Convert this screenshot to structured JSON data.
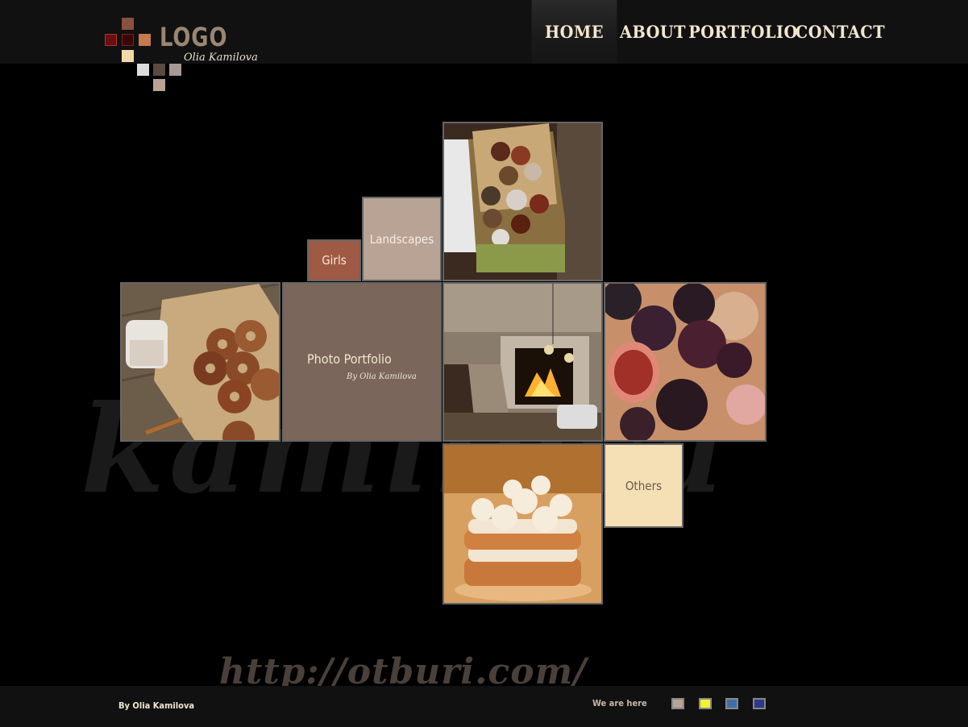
{
  "logo": {
    "word": "LOGO",
    "signature": "Olia Kamilova"
  },
  "nav": {
    "home": "HOME",
    "about": "ABOUT",
    "portfolio": "PORTFOLIO",
    "contact": "CONTACT"
  },
  "tiles": {
    "girls": "Girls",
    "landscapes": "Landscapes",
    "photo_portfolio": "Photo Portfolio",
    "photo_portfolio_sig": "By Olia Kamilova",
    "others": "Others"
  },
  "watermark": {
    "url": "http://otburi.com/",
    "background_word": "kamilova"
  },
  "footer": {
    "credit": "By Olia Kamilova",
    "we_are_here": "We are here"
  },
  "swatches": [
    "#b9a296",
    "#f2f230",
    "#3f6fa8",
    "#2a3a8a"
  ],
  "colors": {
    "accent_brown": "#9e5a45",
    "tan": "#b8a394",
    "portfolio_bg": "#7a665a",
    "cream": "#f5dfb4"
  },
  "icons": [
    "logo-mosaic-icon"
  ]
}
